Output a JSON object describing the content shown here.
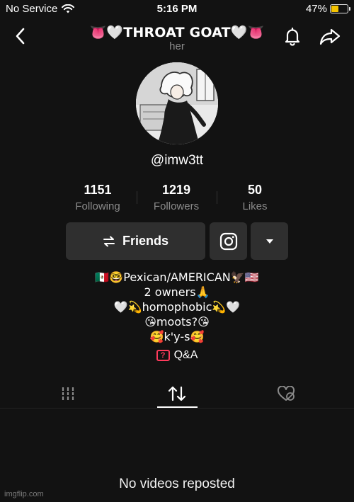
{
  "status_bar": {
    "carrier": "No Service",
    "time": "5:16 PM",
    "battery_percent": "47%",
    "battery_level": 0.47,
    "battery_color": "#f5c400"
  },
  "header": {
    "title": "👅🤍THROAT GOAT🤍👅",
    "pronoun": "her",
    "back_icon": "chevron-left-icon",
    "bell_icon": "bell-icon",
    "share_icon": "share-arrow-icon"
  },
  "profile": {
    "username": "@imw3tt",
    "avatar": "anime-character-avatar"
  },
  "stats": [
    {
      "value": "1151",
      "label": "Following"
    },
    {
      "value": "1219",
      "label": "Followers"
    },
    {
      "value": "50",
      "label": "Likes"
    }
  ],
  "actions": {
    "friends_label": "Friends",
    "friends_icon": "swap-arrows-icon",
    "instagram_icon": "instagram-icon",
    "more_icon": "caret-down-icon"
  },
  "bio": [
    "🇲🇽🤓Pexican/AMERICAN🦅🇺🇸",
    "2 owners🙏",
    "🤍💫homophobic💫🤍",
    "😘moots?😘",
    "🥰k'y-s🥰"
  ],
  "qa": {
    "label": "Q&A",
    "icon_glyph": "?",
    "accent": "#ff3b5c"
  },
  "tabs": [
    {
      "name": "videos-grid-icon"
    },
    {
      "name": "repost-icon",
      "active": true
    },
    {
      "name": "liked-hidden-icon"
    }
  ],
  "empty_state": "No videos reposted",
  "watermark": "imgflip.com"
}
